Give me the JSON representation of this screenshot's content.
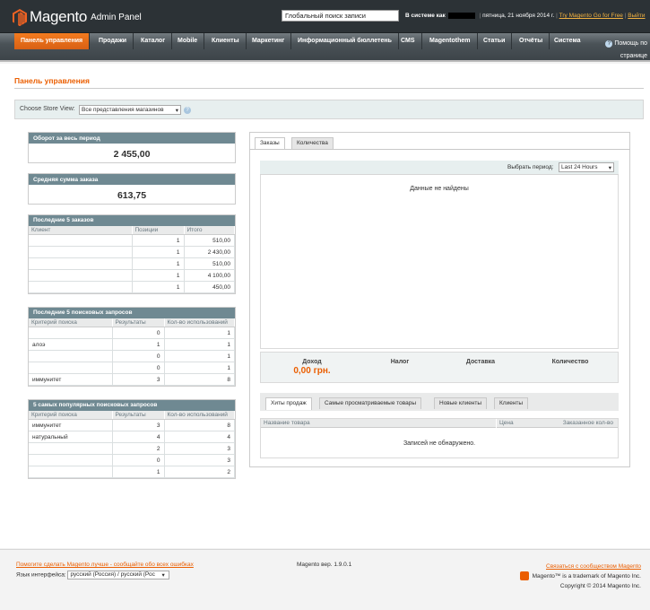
{
  "header": {
    "logo_word": "Magento",
    "logo_sub": "Admin Panel",
    "search_value": "Глобальный поиск записи",
    "logged_in_as": "В системе как",
    "date": "пятница, 21 ноября 2014 г.",
    "try_go": "Try Magento Go for Free",
    "logout": "Выйти"
  },
  "nav": {
    "items": [
      "Панель управления",
      "Продажи",
      "Каталог",
      "Mobile",
      "Клиенты",
      "Маркетинг",
      "Информационный бюллетень",
      "CMS",
      "Magentothem",
      "Статьи",
      "Отчёты",
      "Система"
    ],
    "help_line1": "Помощь по",
    "help_line2": "странице"
  },
  "page": {
    "title": "Панель управления",
    "store_view_label": "Choose Store View:",
    "store_view_value": "Все представления магазинов"
  },
  "summary": {
    "lifetime_label": "Оборот за весь период",
    "lifetime_value": "2 455,00",
    "avg_label": "Средняя сумма заказа",
    "avg_value": "613,75"
  },
  "last_orders": {
    "title": "Последние 5 заказов",
    "columns": [
      "Клиент",
      "Позиции",
      "Итого"
    ],
    "rows": [
      [
        "",
        "1",
        "510,00"
      ],
      [
        "",
        "1",
        "2 430,00"
      ],
      [
        "",
        "1",
        "510,00"
      ],
      [
        "",
        "1",
        "4 100,00"
      ],
      [
        "",
        "1",
        "450,00"
      ]
    ]
  },
  "last_searches": {
    "title": "Последние 5 поисковых запросов",
    "columns": [
      "Критерий поиска",
      "Результаты",
      "Кол-во использований"
    ],
    "rows": [
      [
        "",
        "0",
        "1"
      ],
      [
        "алоэ",
        "1",
        "1"
      ],
      [
        "",
        "0",
        "1"
      ],
      [
        "",
        "0",
        "1"
      ],
      [
        "иммунитет",
        "3",
        "8"
      ]
    ]
  },
  "top_searches": {
    "title": "5 самых популярных поисковых запросов",
    "columns": [
      "Критерий поиска",
      "Результаты",
      "Кол-во использований"
    ],
    "rows": [
      [
        "иммунитет",
        "3",
        "8"
      ],
      [
        "натуральный",
        "4",
        "4"
      ],
      [
        "",
        "2",
        "3"
      ],
      [
        "",
        "0",
        "3"
      ],
      [
        "",
        "1",
        "2"
      ]
    ]
  },
  "diagram": {
    "tabs": [
      "Заказы",
      "Количества"
    ],
    "period_label": "Выбрать период:",
    "period_value": "Last 24 Hours",
    "no_data": "Данные не найдены"
  },
  "totals": {
    "revenue_label": "Доход",
    "revenue_value": "0,00 грн.",
    "tax_label": "Налог",
    "shipping_label": "Доставка",
    "qty_label": "Количество"
  },
  "grid_tabs": {
    "tabs": [
      "Хиты продаж",
      "Самые просматриваемые товары",
      "Новые клиенты",
      "Клиенты"
    ],
    "columns": [
      "Название товара",
      "Цена",
      "Заказанное кол-во"
    ],
    "no_records": "Записей не обнаружено."
  },
  "footer": {
    "bug_link": "Помогите сделать Magento лучше - сообщайте обо всех ошибках",
    "lang_label": "Язык интерфейса:",
    "lang_value": "русский (Россия) / русский (Рос",
    "version": "Magento вер. 1.9.0.1",
    "community_link": "Связаться с сообществом Magento",
    "trademark": "Magento™ is a trademark of Magento Inc.",
    "copyright": "Copyright © 2014 Magento Inc."
  }
}
